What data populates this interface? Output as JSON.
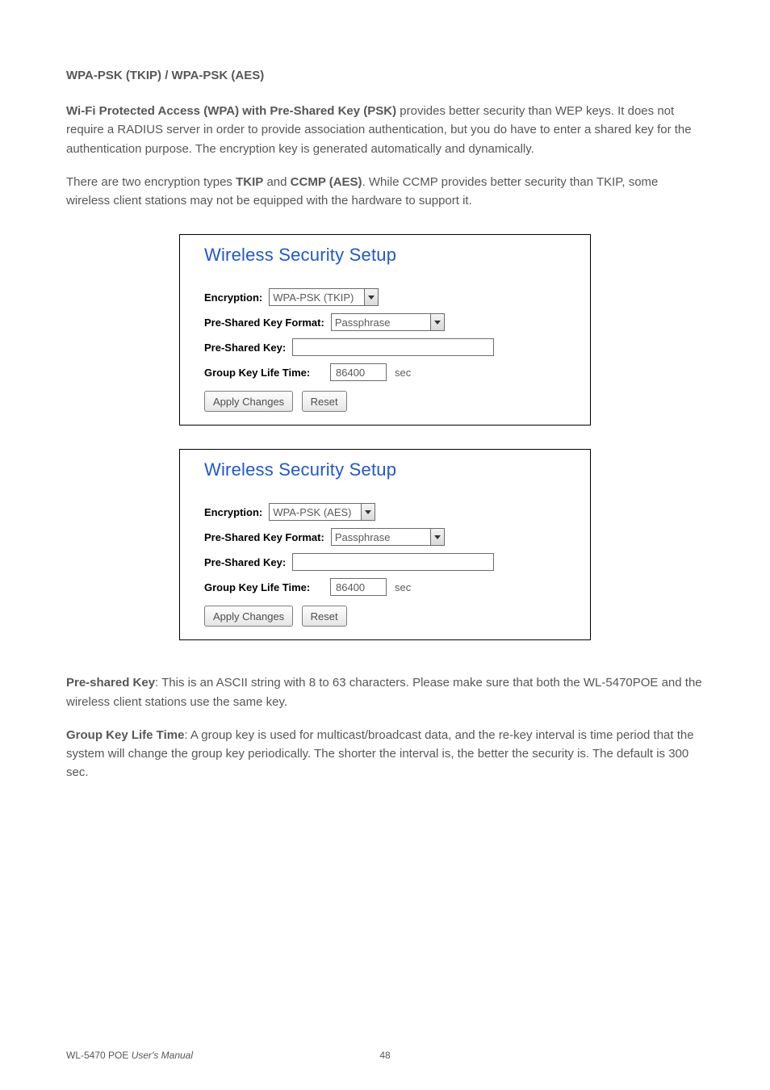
{
  "heading": "WPA-PSK (TKIP) / WPA-PSK (AES)",
  "para1_bold": "Wi-Fi Protected Access (WPA) with Pre-Shared Key (PSK)",
  "para1_rest": " provides better security than WEP keys. It does not require a RADIUS server in order to provide association authentication, but you do have to enter a shared key for the authentication purpose. The encryption key is generated automatically and dynamically.",
  "para2_a": "There are two encryption types ",
  "para2_b1": "TKIP",
  "para2_mid": " and ",
  "para2_b2": "CCMP (AES)",
  "para2_c": ". While CCMP provides better security than TKIP, some wireless client stations may not be equipped with the hardware to support it.",
  "panel": {
    "title": "Wireless Security Setup",
    "labels": {
      "encryption": "Encryption:",
      "pskFormat": "Pre-Shared Key Format:",
      "psk": "Pre-Shared Key:",
      "groupKey": "Group Key Life Time:",
      "sec": "sec"
    },
    "buttons": {
      "apply": "Apply Changes",
      "reset": "Reset"
    }
  },
  "p1": {
    "encryption": "WPA-PSK (TKIP)",
    "pskFormat": "Passphrase",
    "groupKey": "86400"
  },
  "p2": {
    "encryption": "WPA-PSK (AES)",
    "pskFormat": "Passphrase",
    "groupKey": "86400"
  },
  "para3_b": "Pre-shared Key",
  "para3_rest": ": This is an ASCII string with 8 to 63 characters. Please make sure that both the WL-5470POE and the wireless client stations use the same key.",
  "para4_b": "Group Key Life Time",
  "para4_rest": ": A group key is used for multicast/broadcast data, and the re-key interval is time period that the system will change the group key periodically. The shorter the interval is, the better the security is. The default is 300 sec.",
  "footer": {
    "product": "WL-5470 POE ",
    "manual": "User's Manual",
    "page": "48"
  }
}
